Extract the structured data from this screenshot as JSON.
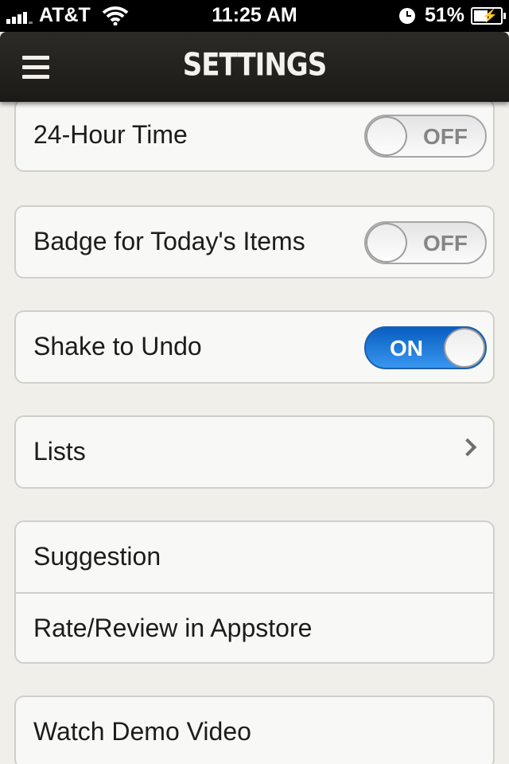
{
  "status_bar": {
    "carrier": "AT&T",
    "time": "11:25 AM",
    "battery": "51%"
  },
  "nav": {
    "title": "SETTINGS",
    "menu_icon": "hamburger-menu-icon"
  },
  "settings": {
    "twenty_four_hour": {
      "label": "24-Hour Time",
      "state": "OFF"
    },
    "badge_today": {
      "label": "Badge for Today's Items",
      "state": "OFF"
    },
    "shake_undo": {
      "label": "Shake to Undo",
      "state": "ON"
    },
    "lists": {
      "label": "Lists"
    },
    "suggestion": {
      "label": "Suggestion"
    },
    "rate_review": {
      "label": "Rate/Review in Appstore"
    },
    "demo_video": {
      "label": "Watch Demo Video"
    }
  },
  "colors": {
    "toggle_on": "#1a73d9",
    "nav_bg": "#231f1b",
    "page_bg": "#f0efe9"
  }
}
